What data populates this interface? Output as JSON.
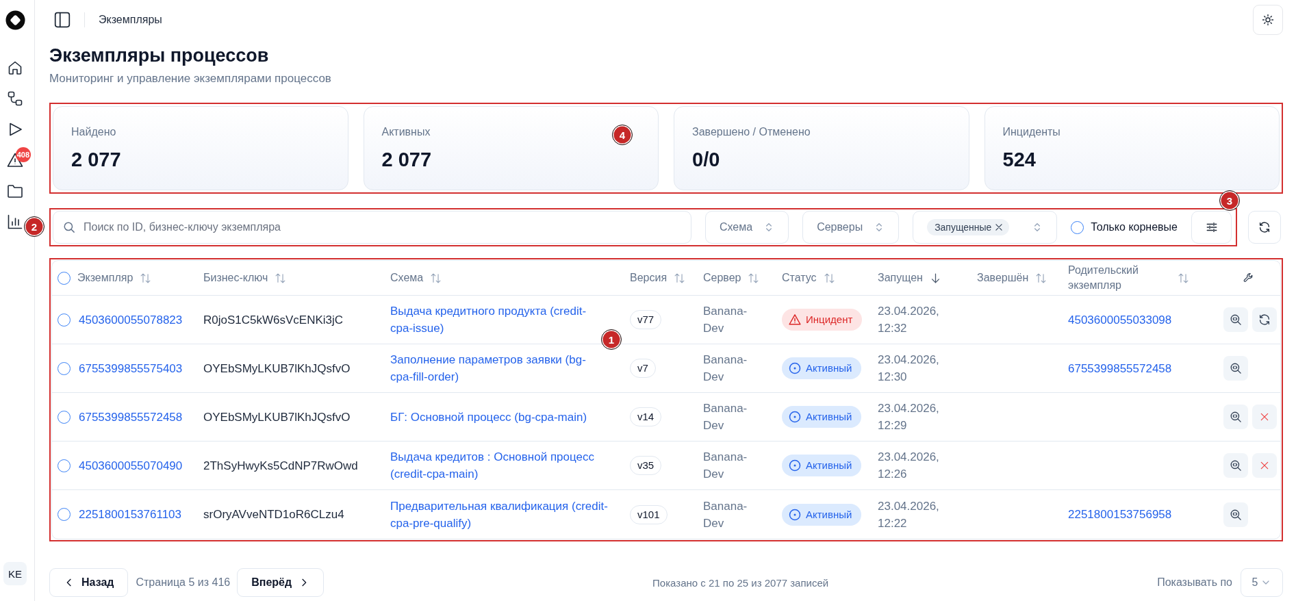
{
  "sidebar": {
    "items": [
      {
        "kind": "home"
      },
      {
        "kind": "flows"
      },
      {
        "kind": "run"
      },
      {
        "kind": "alerts",
        "badge": "408"
      },
      {
        "kind": "folder"
      },
      {
        "kind": "reports"
      }
    ],
    "avatar": "KE"
  },
  "header": {
    "breadcrumb": "Экземпляры"
  },
  "page": {
    "title": "Экземпляры процессов",
    "subtitle": "Мониторинг и управление экземплярами процессов"
  },
  "stats": {
    "callout": "4",
    "cards": [
      {
        "label": "Найдено",
        "value": "2 077"
      },
      {
        "label": "Активных",
        "value": "2 077"
      },
      {
        "label": "Завершено / Отменено",
        "value": "0/0"
      },
      {
        "label": "Инциденты",
        "value": "524"
      }
    ]
  },
  "filters": {
    "callouts": [
      "2",
      "3"
    ],
    "search": {
      "placeholder": "Поиск по ID, бизнес-ключу экземпляра"
    },
    "selects": [
      {
        "placeholder": "Схема"
      },
      {
        "placeholder": "Серверы"
      }
    ],
    "status_select": {
      "chips": [
        "Запущенные"
      ]
    },
    "root_only": {
      "label": "Только корневые",
      "checked": false
    }
  },
  "table": {
    "callout": "1",
    "select_all": {
      "checked": false
    },
    "columns": [
      {
        "label": "Экземпляр",
        "sorted": false
      },
      {
        "label": "Бизнес-ключ",
        "sorted": false
      },
      {
        "label": "Схема",
        "sorted": false
      },
      {
        "label": "Версия",
        "sorted": false
      },
      {
        "label": "Сервер",
        "sorted": false
      },
      {
        "label": "Статус",
        "sorted": false
      },
      {
        "label": "Запущен",
        "sorted": true
      },
      {
        "label": "Завершён",
        "sorted": false
      },
      {
        "label": "Родительский экземпляр",
        "sorted": false
      }
    ],
    "rows": [
      {
        "selected": false,
        "instance": "4503600055078823",
        "business_key": "R0joS1C5kW6sVcENKi3jC",
        "schema": "Выдача кредитного продукта (credit-cpa-issue)",
        "version": "v77",
        "server": "Banana-Dev",
        "status": {
          "kind": "incident",
          "label": "Инцидент"
        },
        "started": "23.04.2026, 12:32",
        "parent": "4503600055033098",
        "actions": [
          {
            "kind": "view"
          },
          {
            "kind": "retry"
          }
        ]
      },
      {
        "selected": false,
        "instance": "6755399855575403",
        "business_key": "OYEbSMyLKUB7lKhJQsfvO",
        "schema": "Заполнение параметров заявки (bg-cpa-fill-order)",
        "version": "v7",
        "server": "Banana-Dev",
        "status": {
          "kind": "active",
          "label": "Активный"
        },
        "started": "23.04.2026, 12:30",
        "parent": "6755399855572458",
        "actions": [
          {
            "kind": "view"
          }
        ]
      },
      {
        "selected": false,
        "instance": "6755399855572458",
        "business_key": "OYEbSMyLKUB7lKhJQsfvO",
        "schema": "БГ: Основной процесс (bg-cpa-main)",
        "version": "v14",
        "server": "Banana-Dev",
        "status": {
          "kind": "active",
          "label": "Активный"
        },
        "started": "23.04.2026, 12:29",
        "actions": [
          {
            "kind": "view"
          },
          {
            "kind": "cancel"
          }
        ]
      },
      {
        "selected": false,
        "instance": "4503600055070490",
        "business_key": "2ThSyHwyKs5CdNP7RwOwd",
        "schema": "Выдача кредитов : Основной процесс (credit-cpa-main)",
        "version": "v35",
        "server": "Banana-Dev",
        "status": {
          "kind": "active",
          "label": "Активный"
        },
        "started": "23.04.2026, 12:26",
        "actions": [
          {
            "kind": "view"
          },
          {
            "kind": "cancel"
          }
        ]
      },
      {
        "selected": false,
        "instance": "2251800153761103",
        "business_key": "srOryAVveNTD1oR6CLzu4",
        "schema": "Предварительная квалификация (credit-cpa-pre-qualify)",
        "version": "v101",
        "server": "Banana-Dev",
        "status": {
          "kind": "active",
          "label": "Активный"
        },
        "started": "23.04.2026, 12:22",
        "parent": "2251800153756958",
        "actions": [
          {
            "kind": "view"
          }
        ]
      }
    ]
  },
  "pagination": {
    "prev": "Назад",
    "page_info": "Страница 5 из 416",
    "next": "Вперёд",
    "summary": "Показано с 21 по 25 из 2077 записей",
    "page_size_label": "Показывать по",
    "page_size": "5"
  }
}
